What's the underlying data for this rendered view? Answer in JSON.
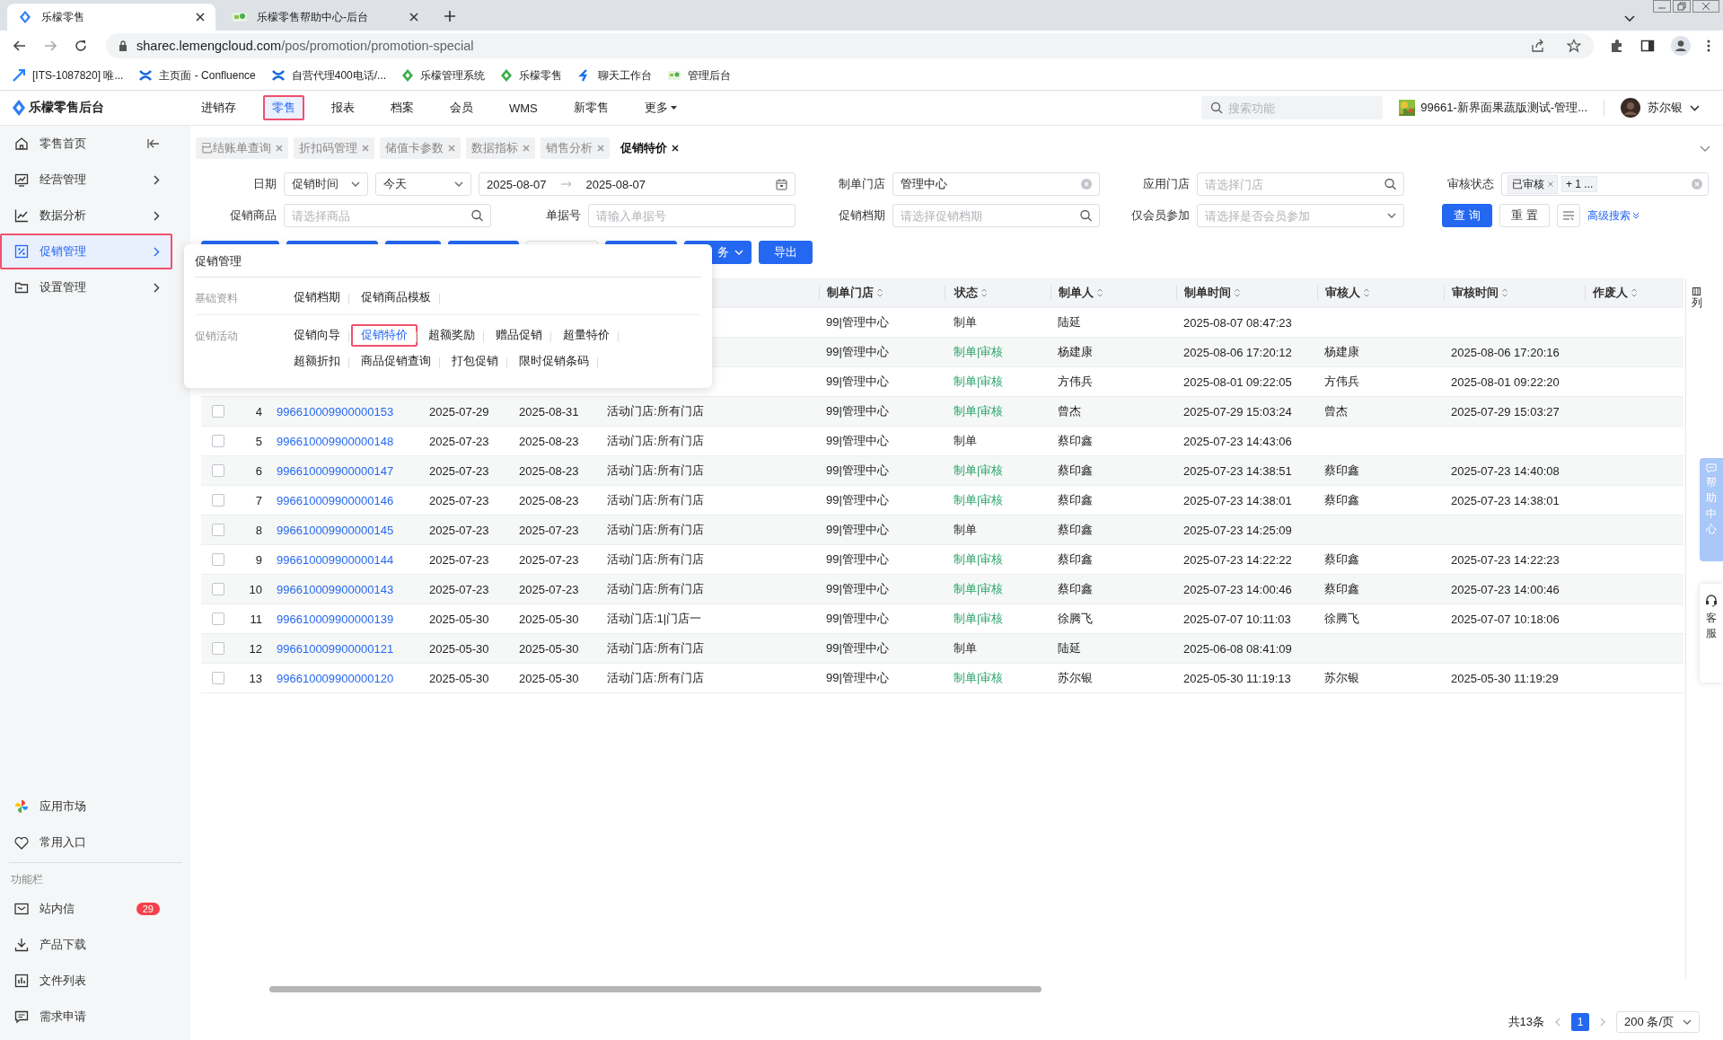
{
  "browser": {
    "tabs": [
      {
        "title": "乐檬零售",
        "selected": true
      },
      {
        "title": "乐檬零售帮助中心-后台",
        "selected": false
      }
    ],
    "url_host": "sharec.lemengcloud.com",
    "url_path": "/pos/promotion/promotion-special",
    "bookmarks": [
      "[ITS-1087820] 唯...",
      "主页面 - Confluence",
      "自营代理400电话/...",
      "乐檬管理系统",
      "乐檬零售",
      "聊天工作台",
      "管理后台"
    ]
  },
  "header": {
    "logo": "乐檬零售后台",
    "nav": [
      {
        "label": "进销存",
        "selected": false
      },
      {
        "label": "零售",
        "selected": true
      },
      {
        "label": "报表",
        "selected": false
      },
      {
        "label": "档案",
        "selected": false
      },
      {
        "label": "会员",
        "selected": false
      },
      {
        "label": "WMS",
        "selected": false
      },
      {
        "label": "新零售",
        "selected": false
      },
      {
        "label": "更多",
        "selected": false
      }
    ],
    "search": {
      "placeholder": "搜索功能"
    },
    "store": "99661-新界面果蔬版测试-管理...",
    "user": "苏尔银"
  },
  "sidebar": {
    "items": [
      {
        "label": "零售首页",
        "selected": false
      },
      {
        "label": "经营管理",
        "selected": false
      },
      {
        "label": "数据分析",
        "selected": false
      },
      {
        "label": "促销管理",
        "selected": true
      },
      {
        "label": "设置管理",
        "selected": false
      }
    ],
    "extras": [
      "应用市场",
      "常用入口"
    ],
    "section_label": "功能栏",
    "tools": [
      {
        "label": "站内信",
        "badge": "29"
      },
      {
        "label": "产品下载"
      },
      {
        "label": "文件列表"
      },
      {
        "label": "需求申请"
      }
    ]
  },
  "page_tabs": [
    {
      "label": "已结账单查询",
      "selected": false
    },
    {
      "label": "折扣码管理",
      "selected": false
    },
    {
      "label": "储值卡参数",
      "selected": false
    },
    {
      "label": "数据指标",
      "selected": false
    },
    {
      "label": "销售分析",
      "selected": false
    },
    {
      "label": "促销特价",
      "selected": true
    }
  ],
  "filters": [
    {
      "label": "日期",
      "kind": "daterange",
      "field": "促销时间",
      "preset": "今天",
      "start": "2025-08-07",
      "end": "2025-08-07"
    },
    {
      "label": "制单门店",
      "kind": "input",
      "value": "管理中心"
    },
    {
      "label": "应用门店",
      "kind": "search",
      "placeholder": "请选择门店"
    },
    {
      "label": "审核状态",
      "kind": "tags",
      "tags": [
        "已审核"
      ],
      "more": "+ 1 ..."
    },
    {
      "label": "促销商品",
      "kind": "search",
      "placeholder": "请选择商品"
    },
    {
      "label": "单据号",
      "kind": "input",
      "placeholder": "请输入单据号"
    },
    {
      "label": "促销档期",
      "kind": "search",
      "placeholder": "请选择促销档期"
    },
    {
      "label": "仅会员参加",
      "kind": "select",
      "placeholder": "请选择是否会员参加"
    }
  ],
  "filter_actions": {
    "query": "查 询",
    "reset": "重 置",
    "advanced": "高级搜索"
  },
  "toolbar": [
    {
      "kind": "covered"
    },
    {
      "kind": "covered"
    },
    {
      "kind": "covered"
    },
    {
      "kind": "covered"
    },
    {
      "kind": "covered_plain"
    },
    {
      "kind": "covered"
    },
    {
      "kind": "dropdown",
      "label": "务"
    },
    {
      "kind": "primary",
      "label": "导出"
    }
  ],
  "popup": {
    "title": "促销管理",
    "sections": [
      {
        "label": "基础资料",
        "links": [
          {
            "label": "促销档期",
            "selected": false
          },
          {
            "label": "促销商品模板",
            "selected": false
          }
        ]
      },
      {
        "label": "促销活动",
        "links": [
          {
            "label": "促销向导",
            "selected": false
          },
          {
            "label": "促销特价",
            "selected": true
          },
          {
            "label": "超额奖励",
            "selected": false
          },
          {
            "label": "赠品促销",
            "selected": false
          },
          {
            "label": "超量特价",
            "selected": false
          },
          {
            "label": "超额折扣",
            "selected": false
          },
          {
            "label": "商品促销查询",
            "selected": false
          },
          {
            "label": "打包促销",
            "selected": false
          },
          {
            "label": "限时促销条码",
            "selected": false
          }
        ]
      }
    ]
  },
  "table": {
    "columns": [
      "制单门店",
      "状态",
      "制单人",
      "制单时间",
      "审核人",
      "审核时间",
      "作废人"
    ],
    "rows": [
      {
        "store": "99|管理中心",
        "status": "制单",
        "approved": false,
        "maker": "陆延",
        "made_at": "2025-08-07 08:47:23"
      },
      {
        "store": "99|管理中心",
        "status": "制单|审核",
        "approved": true,
        "maker": "杨建康",
        "made_at": "2025-08-06 17:20:12",
        "auditor": "杨建康",
        "audited_at": "2025-08-06 17:20:16"
      },
      {
        "store": "99|管理中心",
        "status": "制单|审核",
        "approved": true,
        "maker": "方伟兵",
        "made_at": "2025-08-01 09:22:05",
        "auditor": "方伟兵",
        "audited_at": "2025-08-01 09:22:20"
      },
      {
        "checked": false,
        "index": "4",
        "number": "996610009900000153",
        "start": "2025-07-29",
        "end": "2025-08-31",
        "scope": "活动门店:所有门店",
        "store": "99|管理中心",
        "status": "制单|审核",
        "approved": true,
        "maker": "曾杰",
        "made_at": "2025-07-29 15:03:24",
        "auditor": "曾杰",
        "audited_at": "2025-07-29 15:03:27"
      },
      {
        "checked": false,
        "index": "5",
        "number": "996610009900000148",
        "start": "2025-07-23",
        "end": "2025-08-23",
        "scope": "活动门店:所有门店",
        "store": "99|管理中心",
        "status": "制单",
        "approved": false,
        "maker": "蔡印鑫",
        "made_at": "2025-07-23 14:43:06"
      },
      {
        "checked": false,
        "index": "6",
        "number": "996610009900000147",
        "start": "2025-07-23",
        "end": "2025-08-23",
        "scope": "活动门店:所有门店",
        "store": "99|管理中心",
        "status": "制单|审核",
        "approved": true,
        "maker": "蔡印鑫",
        "made_at": "2025-07-23 14:38:51",
        "auditor": "蔡印鑫",
        "audited_at": "2025-07-23 14:40:08"
      },
      {
        "checked": false,
        "index": "7",
        "number": "996610009900000146",
        "start": "2025-07-23",
        "end": "2025-08-23",
        "scope": "活动门店:所有门店",
        "store": "99|管理中心",
        "status": "制单|审核",
        "approved": true,
        "maker": "蔡印鑫",
        "made_at": "2025-07-23 14:38:01",
        "auditor": "蔡印鑫",
        "audited_at": "2025-07-23 14:38:01"
      },
      {
        "checked": false,
        "index": "8",
        "number": "996610009900000145",
        "start": "2025-07-23",
        "end": "2025-07-23",
        "scope": "活动门店:所有门店",
        "store": "99|管理中心",
        "status": "制单",
        "approved": false,
        "maker": "蔡印鑫",
        "made_at": "2025-07-23 14:25:09"
      },
      {
        "checked": false,
        "index": "9",
        "number": "996610009900000144",
        "start": "2025-07-23",
        "end": "2025-07-23",
        "scope": "活动门店:所有门店",
        "store": "99|管理中心",
        "status": "制单|审核",
        "approved": true,
        "maker": "蔡印鑫",
        "made_at": "2025-07-23 14:22:22",
        "auditor": "蔡印鑫",
        "audited_at": "2025-07-23 14:22:23"
      },
      {
        "checked": false,
        "index": "10",
        "number": "996610009900000143",
        "start": "2025-07-23",
        "end": "2025-07-23",
        "scope": "活动门店:所有门店",
        "store": "99|管理中心",
        "status": "制单|审核",
        "approved": true,
        "maker": "蔡印鑫",
        "made_at": "2025-07-23 14:00:46",
        "auditor": "蔡印鑫",
        "audited_at": "2025-07-23 14:00:46"
      },
      {
        "checked": false,
        "index": "11",
        "number": "996610009900000139",
        "start": "2025-05-30",
        "end": "2025-05-30",
        "scope": "活动门店:1|门店一",
        "store": "99|管理中心",
        "status": "制单|审核",
        "approved": true,
        "maker": "徐腾飞",
        "made_at": "2025-07-07 10:11:03",
        "auditor": "徐腾飞",
        "audited_at": "2025-07-07 10:18:06"
      },
      {
        "checked": false,
        "index": "12",
        "number": "996610009900000121",
        "start": "2025-05-30",
        "end": "2025-05-30",
        "scope": "活动门店:所有门店",
        "store": "99|管理中心",
        "status": "制单",
        "approved": false,
        "maker": "陆延",
        "made_at": "2025-06-08 08:41:09"
      },
      {
        "checked": false,
        "index": "13",
        "number": "996610009900000120",
        "start": "2025-05-30",
        "end": "2025-05-30",
        "scope": "活动门店:所有门店",
        "store": "99|管理中心",
        "status": "制单|审核",
        "approved": true,
        "maker": "苏尔银",
        "made_at": "2025-05-30 11:19:13",
        "auditor": "苏尔银",
        "audited_at": "2025-05-30 11:19:29"
      }
    ]
  },
  "column_settings": "列",
  "pagination": {
    "total": "共13条",
    "pages": [
      {
        "label": "1",
        "selected": true
      }
    ],
    "page_size": "200 条/页"
  },
  "floating": {
    "help": "帮助中心",
    "service": "客服"
  }
}
